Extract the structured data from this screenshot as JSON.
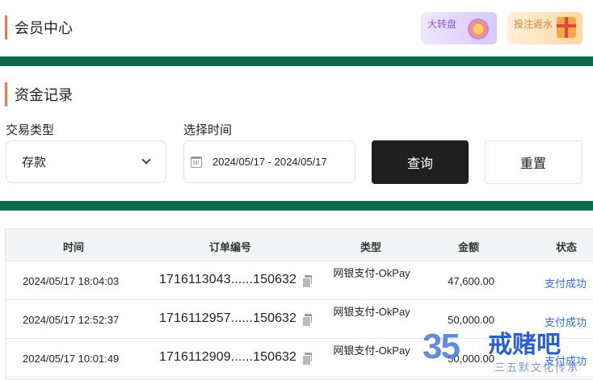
{
  "header": {
    "title": "会员中心",
    "promos": [
      {
        "label": "大转盘",
        "icon": "prize-wheel-icon",
        "color": "#8a5ad0"
      },
      {
        "label": "投注返水",
        "icon": "gift-box-icon",
        "color": "#d48a2d"
      }
    ]
  },
  "funds": {
    "title": "资金记录",
    "filters": {
      "type_label": "交易类型",
      "type_value": "存款",
      "time_label": "选择时间",
      "date_range": "2024/05/17 - 2024/05/17"
    },
    "query_label": "查询",
    "reset_label": "重置"
  },
  "table": {
    "columns": [
      "时间",
      "订单编号",
      "类型",
      "金额",
      "状态"
    ],
    "rows": [
      {
        "time": "2024/05/17 18:04:03",
        "order": "1716113043......150632",
        "type": "网银支付-OkPay",
        "amount": "47,600.00",
        "status": "支付成功"
      },
      {
        "time": "2024/05/17 12:52:37",
        "order": "1716112957......150632",
        "type": "网银支付-OkPay",
        "amount": "50,000.00",
        "status": "支付成功"
      },
      {
        "time": "2024/05/17 10:01:49",
        "order": "1716112909......150632",
        "type": "网银支付-OkPay",
        "amount": "50,000.00",
        "status": "支付成功"
      }
    ]
  },
  "watermark": {
    "number": "35",
    "name": "戒赌吧",
    "sub": "三五默文化传承"
  },
  "colors": {
    "accent_bar": "#e07a4f",
    "divider": "#0b6b48",
    "status_link": "#2f6fd6",
    "query_button": "#1f1f1f"
  }
}
